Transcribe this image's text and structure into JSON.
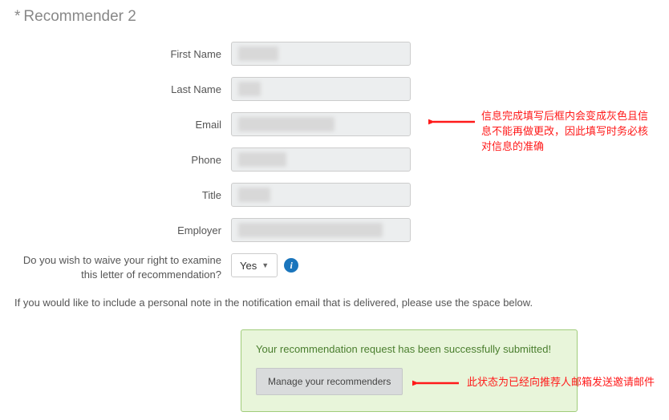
{
  "section": {
    "asterisk": "*",
    "title": "Recommender 2"
  },
  "labels": {
    "firstName": "First Name",
    "lastName": "Last Name",
    "email": "Email",
    "phone": "Phone",
    "title": "Title",
    "employer": "Employer",
    "waive": "Do you wish to waive your right to examine this letter of recommendation?"
  },
  "waiveSelect": {
    "value": "Yes"
  },
  "noteText": "If you would like to include a personal note in the notification email that is delivered, please use the space below.",
  "successBox": {
    "message": "Your recommendation request has been successfully submitted!",
    "button": "Manage your recommenders"
  },
  "annotations": {
    "a1": "信息完成填写后框内会变成灰色且信息不能再做更改，因此填写时务必核对信息的准确",
    "a2": "此状态为已经向推荐人邮箱发送邀请邮件"
  }
}
